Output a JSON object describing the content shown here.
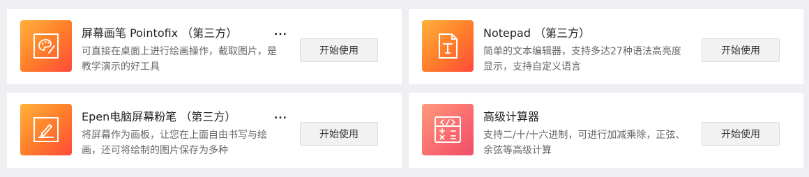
{
  "apps": [
    {
      "title": "屏幕画笔 Pointofix （第三方）",
      "more": "...",
      "description": "可直接在桌面上进行绘画操作，截取图片，是教学演示的好工具",
      "button": "开始使用",
      "icon": "palette-icon"
    },
    {
      "title": "Notepad （第三方）",
      "more": "",
      "description": "简单的文本编辑器，支持多达27种语法高亮度显示，支持自定义语言",
      "button": "开始使用",
      "icon": "text-file-icon"
    },
    {
      "title": "Epen电脑屏幕粉笔 （第三方）",
      "more": "...",
      "description": "将屏幕作为画板，让您在上面自由书写与绘画，还可将绘制的图片保存为多种",
      "button": "开始使用",
      "icon": "pen-draw-icon"
    },
    {
      "title": "高级计算器",
      "more": "",
      "description": "支持二/十/十六进制，可进行加减乘除，正弦、余弦等高级计算",
      "button": "开始使用",
      "icon": "calculator-icon"
    }
  ],
  "colors": {
    "page_background": "#eeeef3",
    "card_background": "#ffffff",
    "icon_orange": "#ff7a2a",
    "icon_pink": "#f9686e",
    "button_background": "#f2f2f2"
  }
}
